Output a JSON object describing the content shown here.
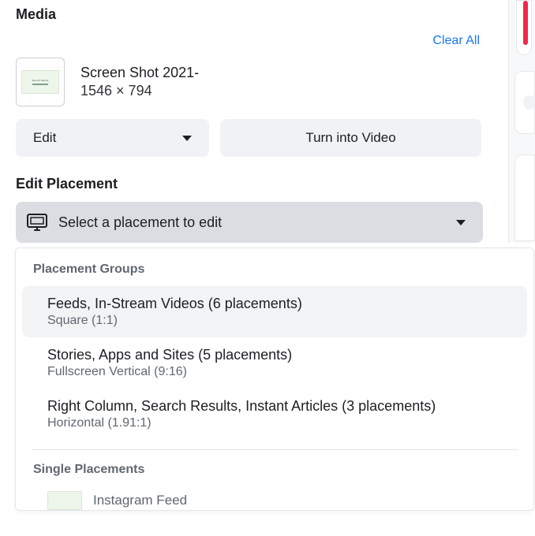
{
  "section_title": "Media",
  "clear_all": "Clear All",
  "media": {
    "name": "Screen Shot 2021-",
    "dimensions": "1546 × 794"
  },
  "buttons": {
    "edit": "Edit",
    "turn_into_video": "Turn into Video"
  },
  "edit_placement_heading": "Edit Placement",
  "placement_select_label": "Select a placement to edit",
  "dropdown": {
    "group_label": "Placement Groups",
    "groups": [
      {
        "title": "Feeds, In-Stream Videos (6 placements)",
        "sub": "Square (1:1)"
      },
      {
        "title": "Stories, Apps and Sites (5 placements)",
        "sub": "Fullscreen Vertical (9:16)"
      },
      {
        "title": "Right Column, Search Results, Instant Articles (3 placements)",
        "sub": "Horizontal (1.91:1)"
      }
    ],
    "single_label": "Single Placements",
    "singles": [
      {
        "label": "Instagram Feed"
      }
    ]
  }
}
